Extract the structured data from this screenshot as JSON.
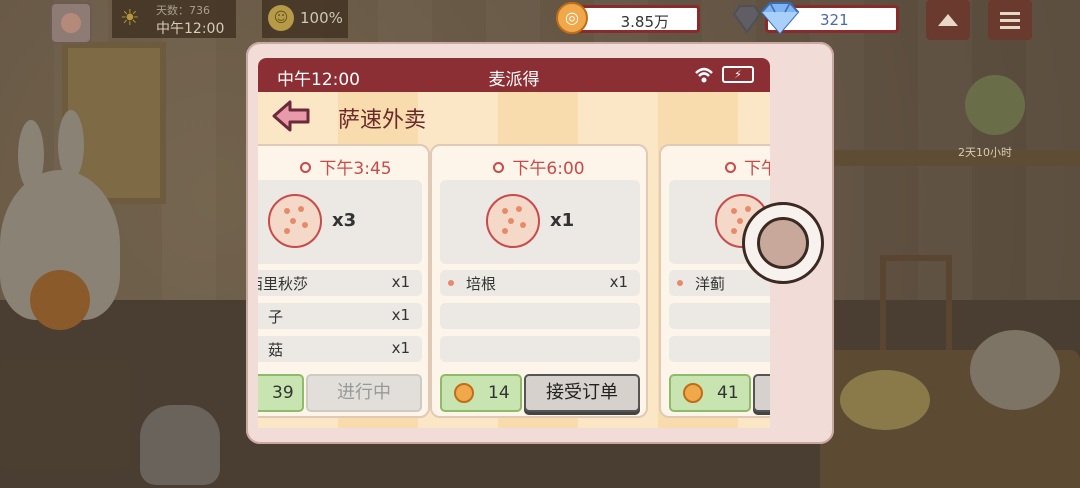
{
  "hud": {
    "weather_line1": "天数：736",
    "weather_line2": "中午12:00",
    "mood_pct": "100%",
    "coins": "3.85万",
    "gems": "321",
    "timer": "2天10小时"
  },
  "phone": {
    "status_time": "中午12:00",
    "app_name": "麦派得",
    "page_title": "萨速外卖"
  },
  "orders": [
    {
      "time": "下午3:45",
      "qty": "x3",
      "items": [
        {
          "name": "西里秋莎",
          "count": "x1"
        },
        {
          "name": "子",
          "count": "x1"
        },
        {
          "name": "菇",
          "count": "x1"
        }
      ],
      "reward": "39",
      "action": "进行中"
    },
    {
      "time": "下午6:00",
      "qty": "x1",
      "items": [
        {
          "name": "培根",
          "count": "x1"
        },
        {
          "name": "",
          "count": ""
        },
        {
          "name": "",
          "count": ""
        }
      ],
      "reward": "14",
      "action": "接受订单"
    },
    {
      "time": "下午",
      "qty": "",
      "items": [
        {
          "name": "洋蓟",
          "count": ""
        },
        {
          "name": "",
          "count": ""
        },
        {
          "name": "",
          "count": ""
        }
      ],
      "reward": "41",
      "action": ""
    }
  ],
  "colors": {
    "status_bar": "#8c2f35",
    "accent_red": "#c94a4a",
    "reward_green": "#c8e4b0",
    "screen_bg": "#fbecd0"
  },
  "icons": [
    "sun-icon",
    "smiley-icon",
    "coin-icon",
    "diamond-icon",
    "up-arrow-icon",
    "menu-icon",
    "wifi-icon",
    "battery-charging-icon",
    "back-arrow-icon",
    "clock-icon",
    "pizza-icon"
  ]
}
